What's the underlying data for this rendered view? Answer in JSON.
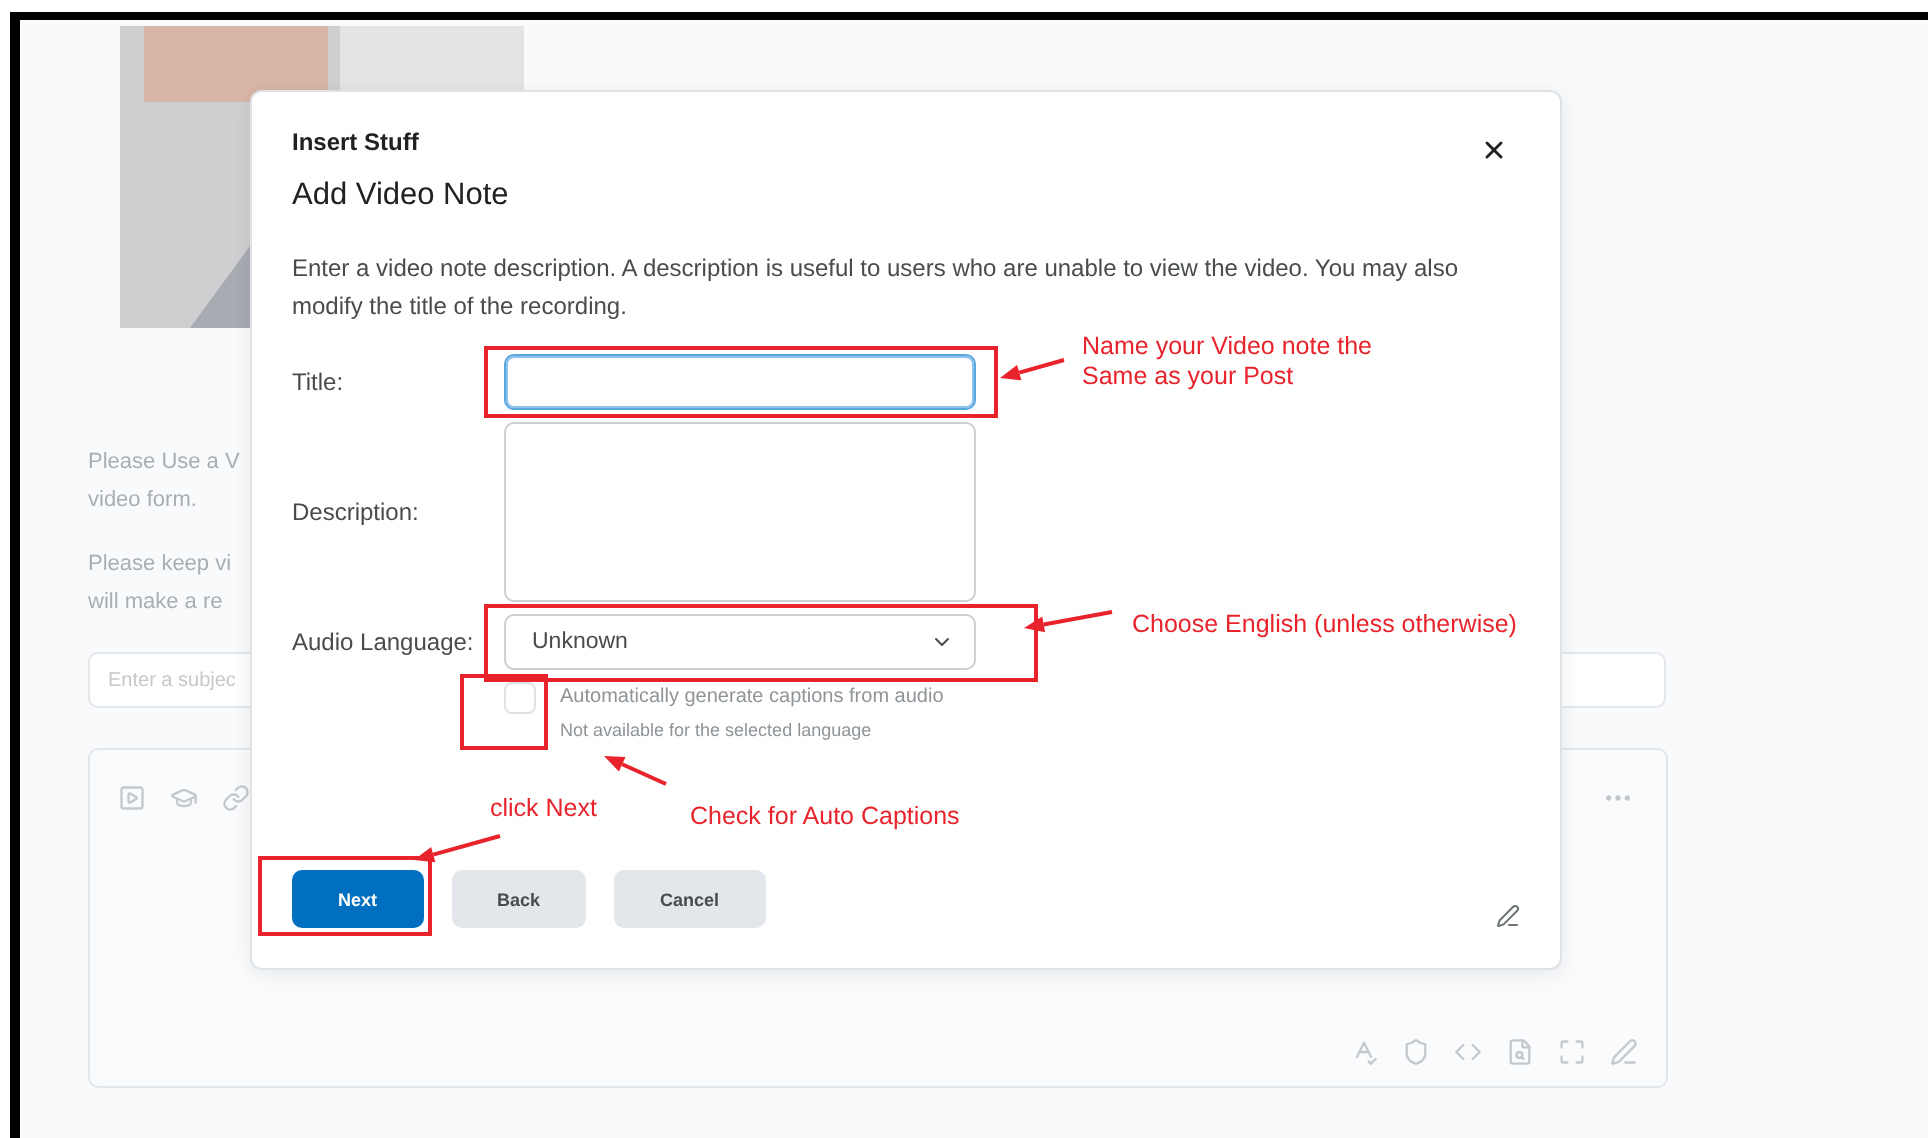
{
  "background": {
    "intro_lines": [
      "Please Use a V",
      "video form.",
      "Please keep vi",
      "will make a re"
    ],
    "subject_field": {
      "placeholder": "Enter a subjec"
    }
  },
  "dialog": {
    "kicker": "Insert Stuff",
    "title": "Add Video Note",
    "description": "Enter a video note description. A description is useful to users who are unable to view the video. You may also modify the title of the recording.",
    "fields": [
      {
        "kind": "text",
        "label": "Title:",
        "focused": true
      },
      {
        "kind": "textarea",
        "label": "Description:",
        "focused": false
      },
      {
        "kind": "select",
        "label": "Audio Language:",
        "value": "Unknown",
        "focused": false
      }
    ],
    "captions": {
      "label": "Automatically generate captions from audio",
      "note": "Not available for the selected language",
      "checked": false,
      "disabled": true
    },
    "buttons": [
      {
        "label": "Next",
        "primary": true
      },
      {
        "label": "Back",
        "primary": false
      },
      {
        "label": "Cancel",
        "primary": false
      }
    ]
  },
  "annotations": [
    "Name your Video note the\nSame as your Post",
    "Choose English (unless otherwise)",
    "Check for Auto Captions",
    "click Next"
  ]
}
